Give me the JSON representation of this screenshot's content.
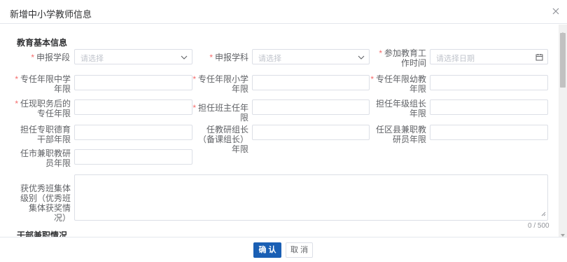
{
  "dialog": {
    "title": "新增中小学教师信息"
  },
  "sections": {
    "basic": "教育基本信息",
    "cadre": "干部兼职情况"
  },
  "fields": {
    "stage": {
      "label": "申报学段",
      "placeholder": "请选择",
      "required": true
    },
    "subject": {
      "label": "申报学科",
      "placeholder": "请选择",
      "required": true
    },
    "work_start": {
      "label": "参加教育工作时间",
      "placeholder": "请选择日期",
      "required": true
    },
    "years_middle": {
      "label": "专任年限中学年限",
      "required": true
    },
    "years_primary": {
      "label": "专任年限小学年限",
      "required": true
    },
    "years_kinder": {
      "label": "专任年限幼教年限",
      "required": true
    },
    "years_after_current": {
      "label": "任现职务后的专任年限",
      "required": true
    },
    "years_head_teacher": {
      "label": "担任班主任年限",
      "required": true
    },
    "years_grade_leader": {
      "label": "担任年级组长年限",
      "required": false
    },
    "years_moral_cadre": {
      "label": "担任专职德育干部年限",
      "required": false
    },
    "years_research_leader": {
      "label": "任教研组长（备课组长）年限",
      "required": false
    },
    "years_district_researcher": {
      "label": "任区县兼职教研员年限",
      "required": false
    },
    "years_city_researcher": {
      "label": "任市兼职教研员年限",
      "required": false
    },
    "excellent_class": {
      "label": "获优秀班集体级别（优秀班集体获奖情况）",
      "counter": "0 / 500"
    }
  },
  "footer": {
    "confirm": "确 认",
    "cancel": "取 消"
  },
  "colors": {
    "primary": "#1a5fb4",
    "required": "#f56c6c",
    "border": "#dcdfe6"
  }
}
